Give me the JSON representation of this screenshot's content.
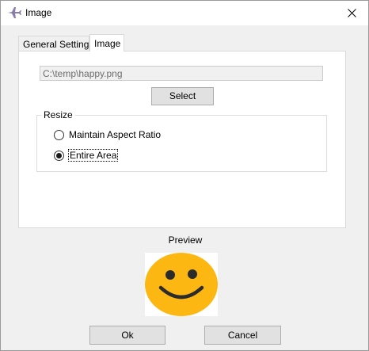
{
  "window": {
    "title": "Image",
    "close_icon": "close-icon",
    "app_icon": "airplane-icon"
  },
  "tabs": [
    {
      "label": "General Settings",
      "selected": false
    },
    {
      "label": "Image",
      "selected": true
    }
  ],
  "image_tab": {
    "path_value": "C:\\temp\\happy.png",
    "select_label": "Select",
    "resize": {
      "legend": "Resize",
      "options": [
        {
          "label": "Maintain Aspect Ratio",
          "checked": false
        },
        {
          "label": "Entire Area",
          "checked": true
        }
      ]
    }
  },
  "preview": {
    "label": "Preview",
    "image_icon": "smiley-face-icon",
    "face_color": "#fcb713",
    "feature_color": "#2b2b2b"
  },
  "footer": {
    "ok_label": "Ok",
    "cancel_label": "Cancel"
  }
}
